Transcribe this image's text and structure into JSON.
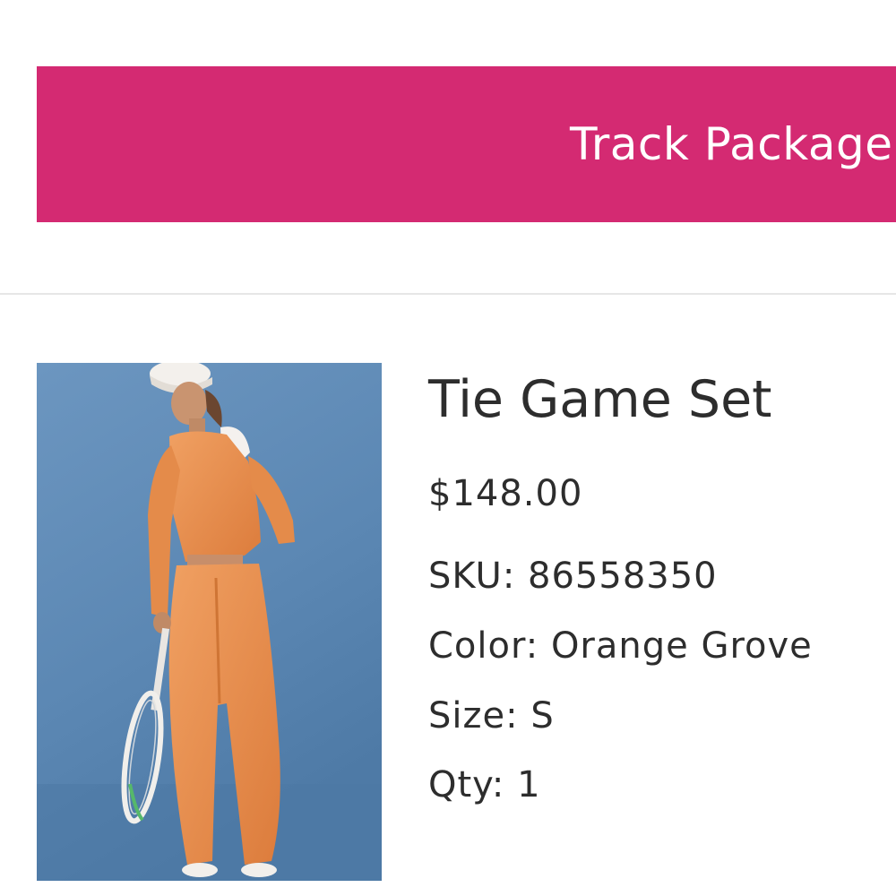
{
  "track_button": {
    "label": "Track Package",
    "color": "#d42a72"
  },
  "product": {
    "name": "Tie Game Set",
    "price": "$148.00",
    "sku_label": "SKU:",
    "sku": "86558350",
    "color_label": "Color:",
    "color": "Orange Grove",
    "size_label": "Size:",
    "size": "S",
    "qty_label": "Qty:",
    "qty": "1",
    "image_background": "#5f8ab5",
    "outfit_color": "#e98d4c"
  }
}
